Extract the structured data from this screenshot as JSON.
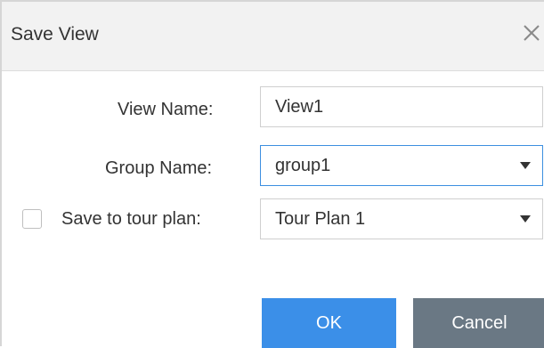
{
  "dialog": {
    "title": "Save View",
    "close_icon": "close-icon"
  },
  "form": {
    "view_name_label": "View Name:",
    "view_name_value": "View1",
    "group_name_label": "Group Name:",
    "group_name_value": "group1",
    "tour_plan_label": "Save to tour plan:",
    "tour_plan_checked": false,
    "tour_plan_value": "Tour Plan 1",
    "dropdown_icon": "caret-down-icon"
  },
  "buttons": {
    "ok_label": "OK",
    "cancel_label": "Cancel"
  },
  "colors": {
    "primary": "#3b8fe8",
    "secondary": "#6a7884",
    "focus_border": "#3c8fe0"
  }
}
